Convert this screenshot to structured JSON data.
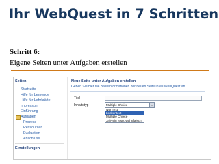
{
  "slide": {
    "title": "Ihr WebQuest in 7 Schritten",
    "step": "Schritt 6:",
    "subtitle": "Eigene Seiten unter Aufgaben erstellen"
  },
  "screenshot": {
    "sidebar": {
      "section_seiten": "Seiten",
      "items": [
        {
          "label": "Startseite"
        },
        {
          "label": "Hilfe für Lernende"
        },
        {
          "label": "Hilfe für Lehrkräfte"
        },
        {
          "label": "Impressum"
        },
        {
          "label": "Einführung"
        },
        {
          "label": "Aufgaben"
        },
        {
          "label": "Prozess"
        },
        {
          "label": "Ressourcen"
        },
        {
          "label": "Evaluation"
        },
        {
          "label": "Abschluss"
        }
      ],
      "section_einstellungen": "Einstellungen"
    },
    "main": {
      "heading": "Neue Seite unter Aufgaben erstellen",
      "description": "Geben Sie hier die Basisinformationen der neuen Seite Ihres WebQuest an.",
      "form": {
        "titel_label": "Titel",
        "titel_value": "",
        "inhaltstyp_label": "Inhaltstyp",
        "inhaltstyp_selected": "Multiple Choice",
        "options": [
          "Nur Text",
          "Lückentext",
          "Multiple Choice",
          "Ja/Nein resp. wahr/falsch"
        ],
        "highlighted_option": "Lückentext"
      }
    }
  },
  "colors": {
    "title": "#17375e",
    "rule": "#d07a1a",
    "link": "#2b5fa8",
    "selected_option": "#2f62b3"
  }
}
